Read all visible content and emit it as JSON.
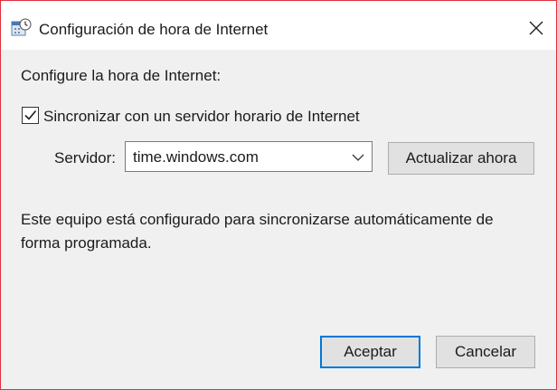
{
  "window": {
    "title": "Configuración de hora de Internet",
    "title_icon": "clock-settings-icon",
    "close_icon": "close-icon"
  },
  "content": {
    "heading": "Configure la hora de Internet:",
    "sync_checkbox": {
      "label": "Sincronizar con un servidor horario de Internet",
      "checked": true
    },
    "server": {
      "label": "Servidor:",
      "value": "time.windows.com"
    },
    "update_button": "Actualizar ahora",
    "status_text": "Este equipo está configurado para sincronizarse automáticamente de forma programada."
  },
  "footer": {
    "ok_label": "Aceptar",
    "cancel_label": "Cancelar"
  },
  "colors": {
    "window_border": "#e0303c",
    "focus_accent": "#0078d7",
    "dialog_background": "#f0f0f0"
  }
}
